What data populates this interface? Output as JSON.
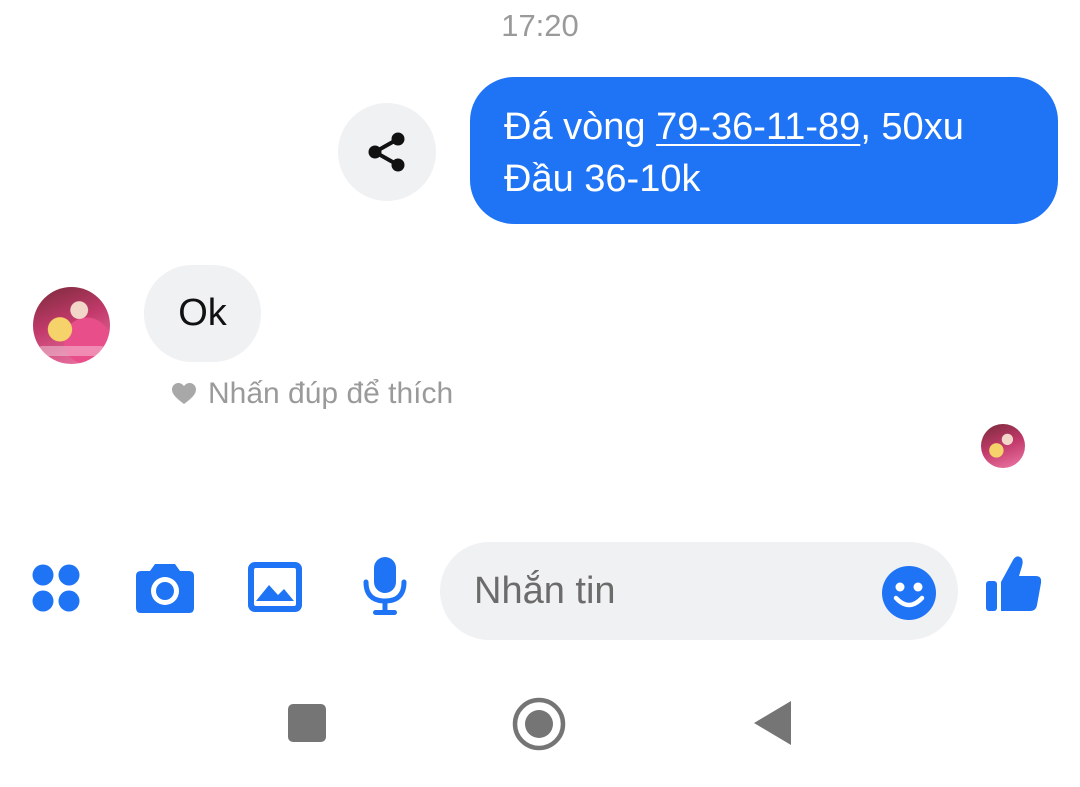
{
  "header": {
    "time": "17:20"
  },
  "messages": {
    "sent": {
      "line1_prefix": "Đá vòng ",
      "line1_numbers": "79-36-11-89",
      "line1_suffix": ", 50xu",
      "line2": "Đầu 36-10k"
    },
    "received": {
      "text": "Ok"
    },
    "like_hint": "Nhấn đúp để thích"
  },
  "composer": {
    "placeholder": "Nhắn tin"
  },
  "icons": {
    "share": "share-icon",
    "menu": "grid-dots-icon",
    "camera": "camera-icon",
    "gallery": "image-icon",
    "mic": "microphone-icon",
    "emoji": "smiley-icon",
    "like": "thumbs-up-icon",
    "heart": "heart-icon",
    "nav_recents": "square-icon",
    "nav_home": "circle-icon",
    "nav_back": "triangle-back-icon"
  },
  "colors": {
    "accent": "#1f74f5",
    "bubble_gray": "#f0f1f3",
    "muted_text": "#9a9a9a",
    "nav_gray": "#757575"
  }
}
